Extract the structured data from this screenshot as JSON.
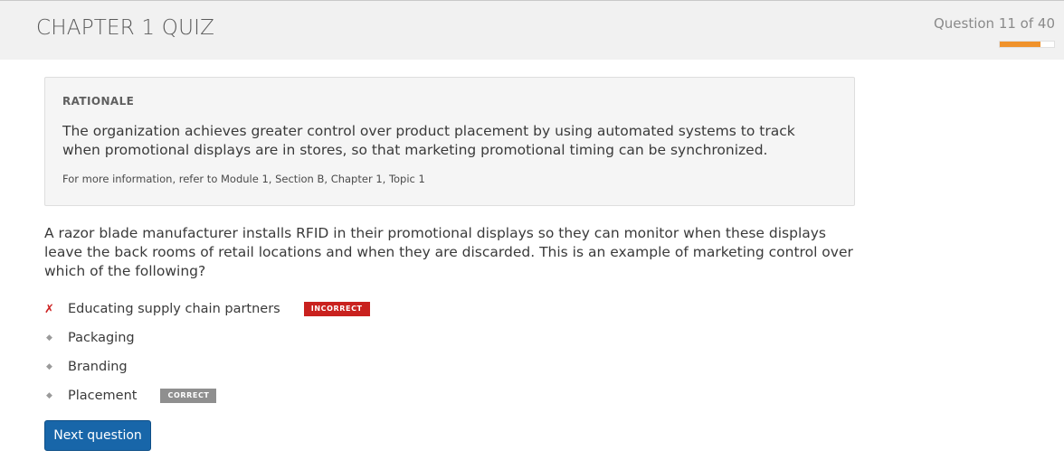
{
  "header": {
    "title": "CHAPTER 1 QUIZ",
    "progress_label": "Question 11 of 40",
    "progress_fraction": 0.75,
    "accent_color": "#f0922b"
  },
  "rationale": {
    "heading": "RATIONALE",
    "text": "The organization achieves greater control over product placement by using automated systems to track when promotional displays are in stores, so that marketing promotional timing can be synchronized.",
    "reference": "For more information, refer to Module 1, Section B, Chapter 1, Topic 1"
  },
  "question": {
    "text": "A razor blade manufacturer installs RFID in their promotional displays so they can monitor when these displays leave the back rooms of retail locations and when they are discarded. This is an example of marketing control over which of the following?"
  },
  "answers": [
    {
      "label": "Educating supply chain partners",
      "mark": "✗",
      "badge": "INCORRECT"
    },
    {
      "label": "Packaging",
      "mark": "◆",
      "badge": ""
    },
    {
      "label": "Branding",
      "mark": "◆",
      "badge": ""
    },
    {
      "label": "Placement",
      "mark": "◆",
      "badge": "CORRECT"
    }
  ],
  "actions": {
    "next_label": "Next question",
    "button_color": "#1866a9"
  },
  "status_colors": {
    "incorrect": "#c9211e",
    "correct": "#8f8f8f"
  }
}
